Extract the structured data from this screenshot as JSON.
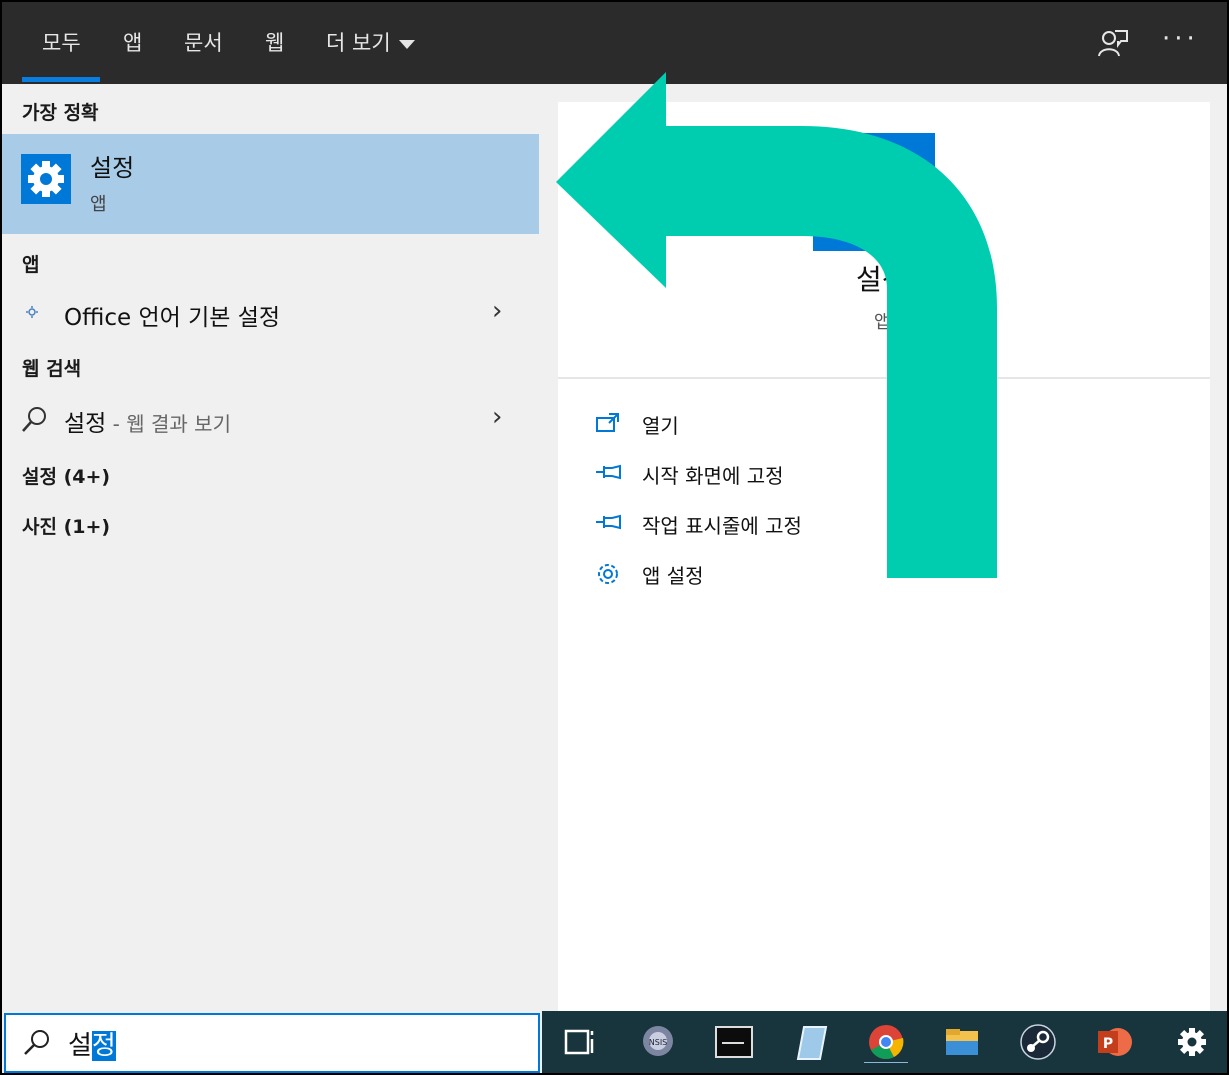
{
  "tabs": [
    {
      "label": "모두",
      "active": true
    },
    {
      "label": "앱"
    },
    {
      "label": "문서"
    },
    {
      "label": "웹"
    },
    {
      "label": "더 보기"
    }
  ],
  "top_icons": {
    "feedback": "feedback-person-icon",
    "more": "···"
  },
  "left": {
    "best_match_header": "가장 정확",
    "best_match": {
      "title": "설정",
      "subtitle": "앱",
      "icon": "gear-icon"
    },
    "apps_header": "앱",
    "apps": [
      {
        "label": "Office 언어 기본 설정",
        "icon": "office-language-icon"
      }
    ],
    "web_header": "웹 검색",
    "web": {
      "term": "설정",
      "suffix": " - 웹 결과 보기"
    },
    "settings_header": "설정 (4+)",
    "photos_header": "사진 (1+)"
  },
  "right": {
    "preview_title": "설정",
    "preview_subtitle": "앱",
    "actions": [
      {
        "label": "열기",
        "icon": "open-icon"
      },
      {
        "label": "시작 화면에 고정",
        "icon": "pin-icon"
      },
      {
        "label": "작업 표시줄에 고정",
        "icon": "pin-icon"
      },
      {
        "label": "앱 설정",
        "icon": "gear-icon"
      }
    ]
  },
  "search": {
    "text_plain": "설",
    "text_selected": "정"
  },
  "colors": {
    "accent": "#0078d7",
    "highlight": "#a8cbe8",
    "arrow": "#00cdb0",
    "taskbar": "#18343d"
  },
  "taskbar": [
    "task-view-icon",
    "nsis-icon",
    "terminal-icon",
    "notepad-icon",
    "chrome-icon",
    "file-explorer-icon",
    "steam-icon",
    "powerpoint-icon",
    "settings-gear-icon"
  ]
}
